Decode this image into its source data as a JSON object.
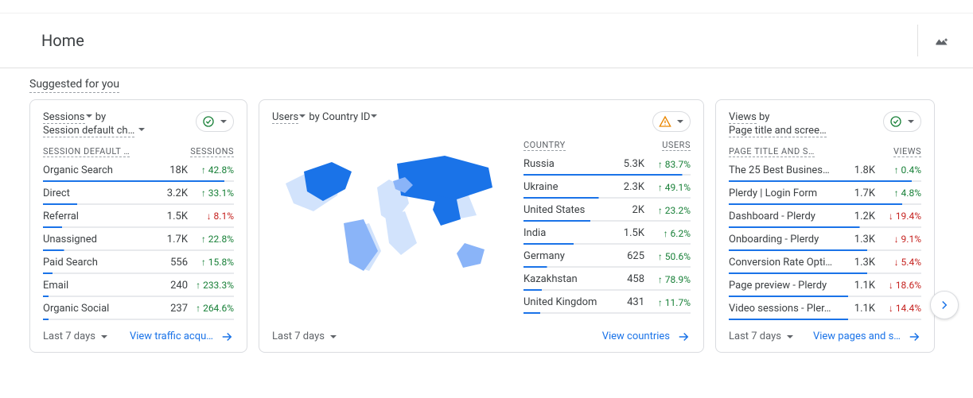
{
  "page_title": "Home",
  "section_title": "Suggested for you",
  "cards": {
    "sessions": {
      "title_prefix": "Sessions",
      "title_by": " by",
      "title_dim": "Session default ch…",
      "col_left": "SESSION DEFAULT …",
      "col_right": "SESSIONS",
      "rows": [
        {
          "label": "Organic Search",
          "value": "18K",
          "delta": "42.8%",
          "dir": "up",
          "p": 95
        },
        {
          "label": "Direct",
          "value": "3.2K",
          "delta": "33.1%",
          "dir": "up",
          "p": 18
        },
        {
          "label": "Referral",
          "value": "1.5K",
          "delta": "8.1%",
          "dir": "down",
          "p": 10
        },
        {
          "label": "Unassigned",
          "value": "1.7K",
          "delta": "22.8%",
          "dir": "up",
          "p": 11
        },
        {
          "label": "Paid Search",
          "value": "556",
          "delta": "15.8%",
          "dir": "up",
          "p": 5
        },
        {
          "label": "Email",
          "value": "240",
          "delta": "233.3%",
          "dir": "up",
          "p": 3
        },
        {
          "label": "Organic Social",
          "value": "237",
          "delta": "264.6%",
          "dir": "up",
          "p": 3
        }
      ],
      "footer_time": "Last 7 days",
      "footer_link": "View traffic acqu…"
    },
    "countries": {
      "title_prefix": "Users",
      "title_by": " by Country ID",
      "col_left": "COUNTRY",
      "col_right": "USERS",
      "rows": [
        {
          "label": "Russia",
          "value": "5.3K",
          "delta": "83.7%",
          "dir": "up",
          "p": 95
        },
        {
          "label": "Ukraine",
          "value": "2.3K",
          "delta": "49.1%",
          "dir": "up",
          "p": 45
        },
        {
          "label": "United States",
          "value": "2K",
          "delta": "23.2%",
          "dir": "up",
          "p": 40
        },
        {
          "label": "India",
          "value": "1.5K",
          "delta": "6.2%",
          "dir": "up",
          "p": 30
        },
        {
          "label": "Germany",
          "value": "625",
          "delta": "50.6%",
          "dir": "up",
          "p": 14
        },
        {
          "label": "Kazakhstan",
          "value": "458",
          "delta": "78.9%",
          "dir": "up",
          "p": 11
        },
        {
          "label": "United Kingdom",
          "value": "431",
          "delta": "11.7%",
          "dir": "up",
          "p": 10
        }
      ],
      "footer_time": "Last 7 days",
      "footer_link": "View countries"
    },
    "views": {
      "title_prefix": "Views",
      "title_by": " by",
      "title_dim": "Page title and scree…",
      "col_left": "PAGE TITLE AND S…",
      "col_right": "VIEWS",
      "rows": [
        {
          "label": "The 25 Best Busines…",
          "value": "1.8K",
          "delta": "0.4%",
          "dir": "up",
          "p": 95
        },
        {
          "label": "Plerdy | Login Form",
          "value": "1.7K",
          "delta": "4.8%",
          "dir": "up",
          "p": 90
        },
        {
          "label": "Dashboard - Plerdy",
          "value": "1.2K",
          "delta": "19.4%",
          "dir": "down",
          "p": 68
        },
        {
          "label": "Onboarding - Plerdy",
          "value": "1.3K",
          "delta": "9.1%",
          "dir": "down",
          "p": 72
        },
        {
          "label": "Conversion Rate Opti…",
          "value": "1.3K",
          "delta": "5.4%",
          "dir": "down",
          "p": 72
        },
        {
          "label": "Page preview - Plerdy",
          "value": "1.1K",
          "delta": "18.6%",
          "dir": "down",
          "p": 62
        },
        {
          "label": "Video sessions - Pler…",
          "value": "1.1K",
          "delta": "14.4%",
          "dir": "down",
          "p": 62
        }
      ],
      "footer_time": "Last 7 days",
      "footer_link": "View pages and s…"
    }
  },
  "chart_data": {
    "type": "map",
    "metric": "Users",
    "dimension": "Country ID",
    "series": [
      {
        "country": "Russia",
        "users": 5300
      },
      {
        "country": "Ukraine",
        "users": 2300
      },
      {
        "country": "United States",
        "users": 2000
      },
      {
        "country": "India",
        "users": 1500
      },
      {
        "country": "Germany",
        "users": 625
      },
      {
        "country": "Kazakhstan",
        "users": 458
      },
      {
        "country": "United Kingdom",
        "users": 431
      }
    ]
  }
}
